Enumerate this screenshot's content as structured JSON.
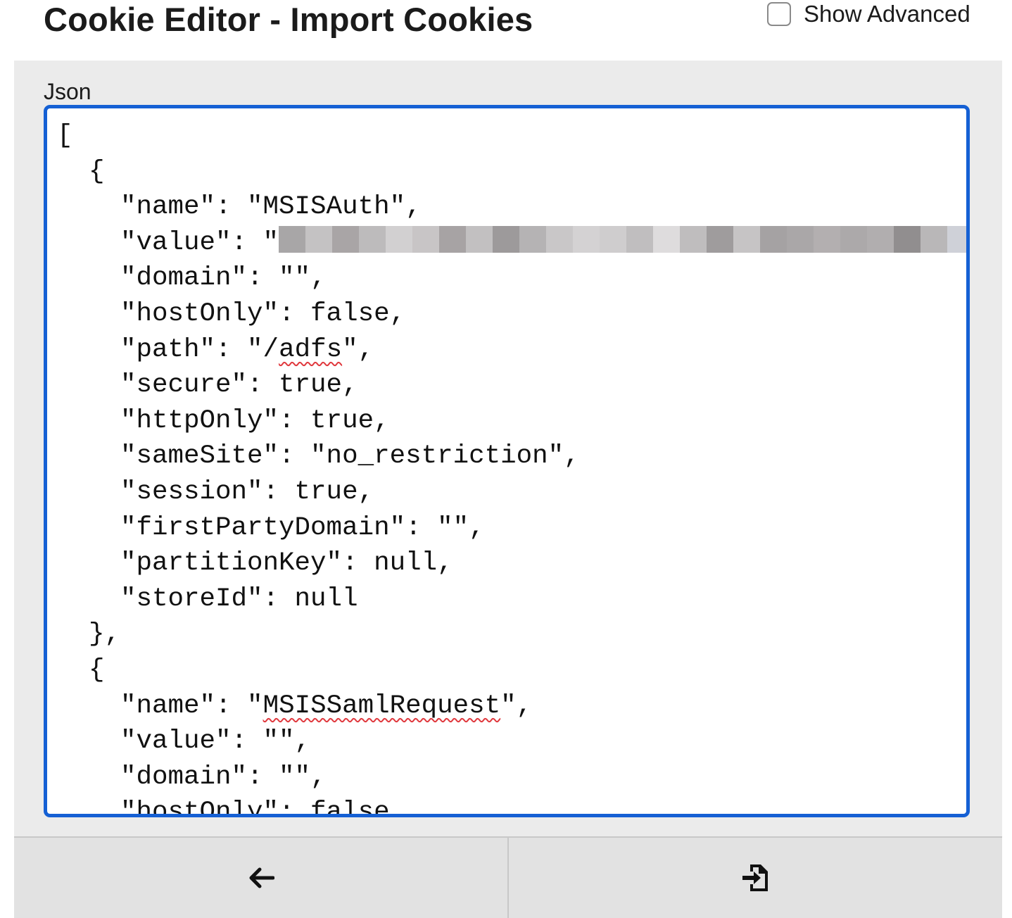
{
  "header": {
    "title": "Cookie Editor - Import Cookies",
    "show_advanced_label": "Show Advanced",
    "show_advanced_checked": false
  },
  "editor": {
    "label": "Json",
    "lines": [
      "[",
      "  {",
      "    \"name\": \"MSISAuth\",",
      "    \"value\": \"",
      "    \"domain\": \"\",",
      "    \"hostOnly\": false,",
      "    \"path\": \"/adfs\",",
      "    \"secure\": true,",
      "    \"httpOnly\": true,",
      "    \"sameSite\": \"no_restriction\",",
      "    \"session\": true,",
      "    \"firstPartyDomain\": \"\",",
      "    \"partitionKey\": null,",
      "    \"storeId\": null",
      "  },",
      "  {",
      "    \"name\": \"MSISSamlRequest\",",
      "    \"value\": \"\",",
      "    \"domain\": \"\",",
      "    \"hostOnly\": false,"
    ],
    "accent_color": "#1560d4"
  },
  "footer": {
    "back_icon": "arrow-left-icon",
    "import_icon": "file-import-icon"
  }
}
